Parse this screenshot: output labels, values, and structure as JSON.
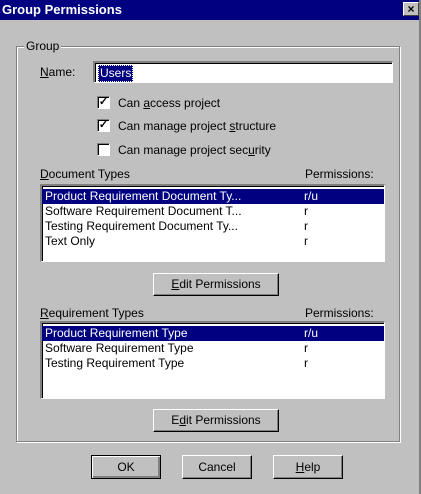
{
  "window": {
    "title": "Group Permissions",
    "close_glyph": "×"
  },
  "group": {
    "label": "Group",
    "name_label_u": "N",
    "name_label_rest": "ame:",
    "name_value": "Users"
  },
  "checkboxes": [
    {
      "pre": "Can ",
      "u": "a",
      "post": "ccess project",
      "checked": true
    },
    {
      "pre": "Can manage project ",
      "u": "s",
      "post": "tructure",
      "checked": true
    },
    {
      "pre": "Can manage project sec",
      "u": "u",
      "post": "rity",
      "checked": false
    }
  ],
  "document_types": {
    "header_u": "D",
    "header_rest": "ocument Types",
    "perm_header": "Permissions:",
    "rows": [
      {
        "name": "Product Requirement Document Ty...",
        "perm": "r/u",
        "selected": true
      },
      {
        "name": "Software Requirement Document T...",
        "perm": "r",
        "selected": false
      },
      {
        "name": "Testing Requirement Document Ty...",
        "perm": "r",
        "selected": false
      },
      {
        "name": "Text Only",
        "perm": "r",
        "selected": false
      }
    ],
    "edit_pre": "",
    "edit_u": "E",
    "edit_post": "dit Permissions"
  },
  "requirement_types": {
    "header_u": "R",
    "header_rest": "equirement Types",
    "perm_header": "Permissions:",
    "rows": [
      {
        "name": "Product Requirement Type",
        "perm": "r/u",
        "selected": true
      },
      {
        "name": "Software Requirement Type",
        "perm": "r",
        "selected": false
      },
      {
        "name": "Testing Requirement Type",
        "perm": "r",
        "selected": false
      }
    ],
    "edit_pre": "E",
    "edit_u": "d",
    "edit_post": "it Permissions"
  },
  "buttons": {
    "ok": "OK",
    "cancel": "Cancel",
    "help_u": "H",
    "help_rest": "elp"
  },
  "check_glyph": "✓"
}
